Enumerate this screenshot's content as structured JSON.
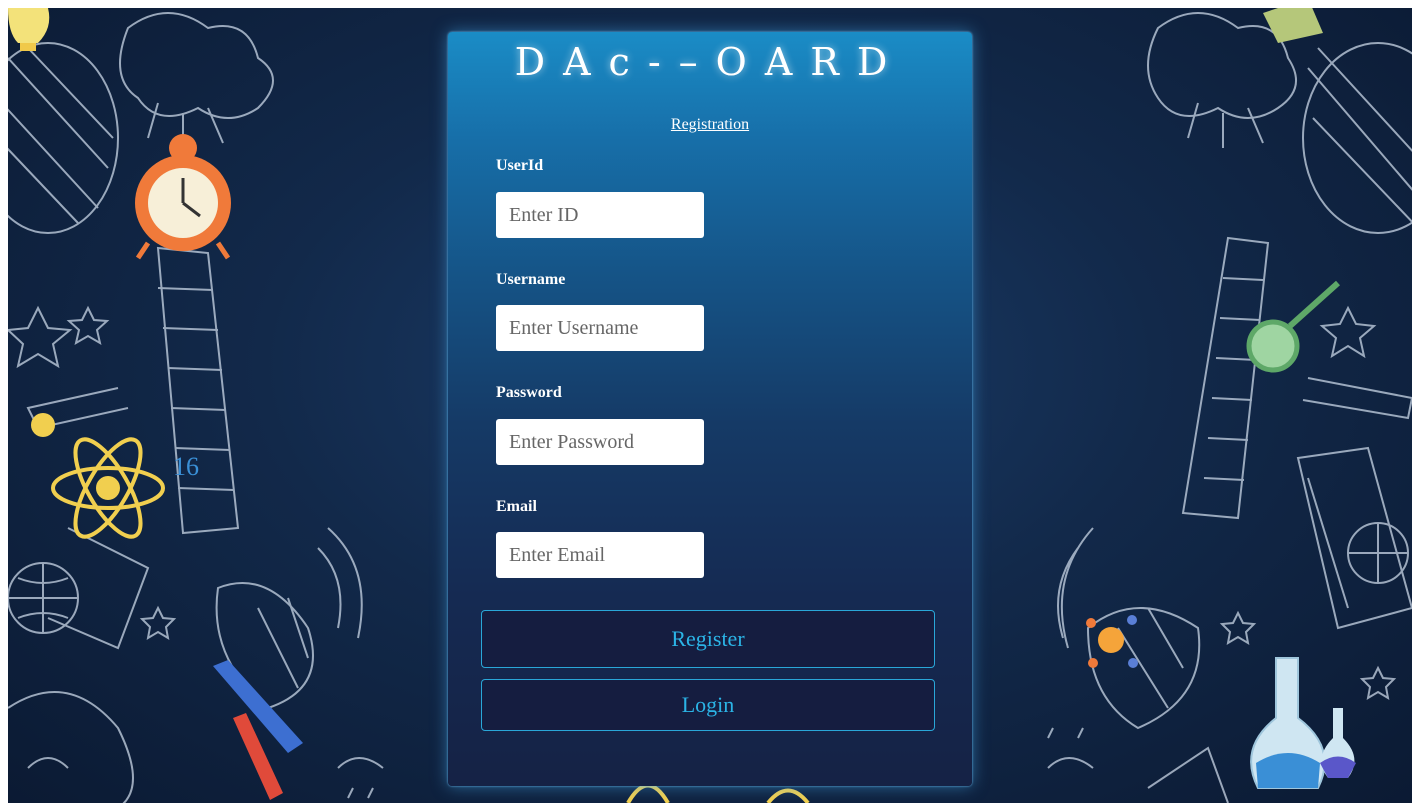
{
  "brand": {
    "title": "DAc-–OARD"
  },
  "form": {
    "registration_link": "Registration",
    "fields": [
      {
        "label": "UserId",
        "placeholder": "Enter ID"
      },
      {
        "label": "Username",
        "placeholder": "Enter Username"
      },
      {
        "label": "Password",
        "placeholder": "Enter Password"
      },
      {
        "label": "Email",
        "placeholder": "Enter Email"
      }
    ],
    "register_label": "Register",
    "login_label": "Login"
  },
  "background": {
    "decor_text": "16",
    "colors": {
      "panel_top": "#1a8cc6",
      "panel_bottom": "#152245",
      "button_text": "#2bb4e6",
      "button_border": "#2aa7d8",
      "background": "#12294a"
    },
    "icons": [
      "lightbulb-icon",
      "alarm-clock-icon",
      "atom-icon",
      "telescope-icon",
      "satellite-dish-icon",
      "pencil-icon",
      "magnifier-icon",
      "flask-icon",
      "planet-icon",
      "globe-icon",
      "book-icon",
      "star-icon"
    ]
  }
}
